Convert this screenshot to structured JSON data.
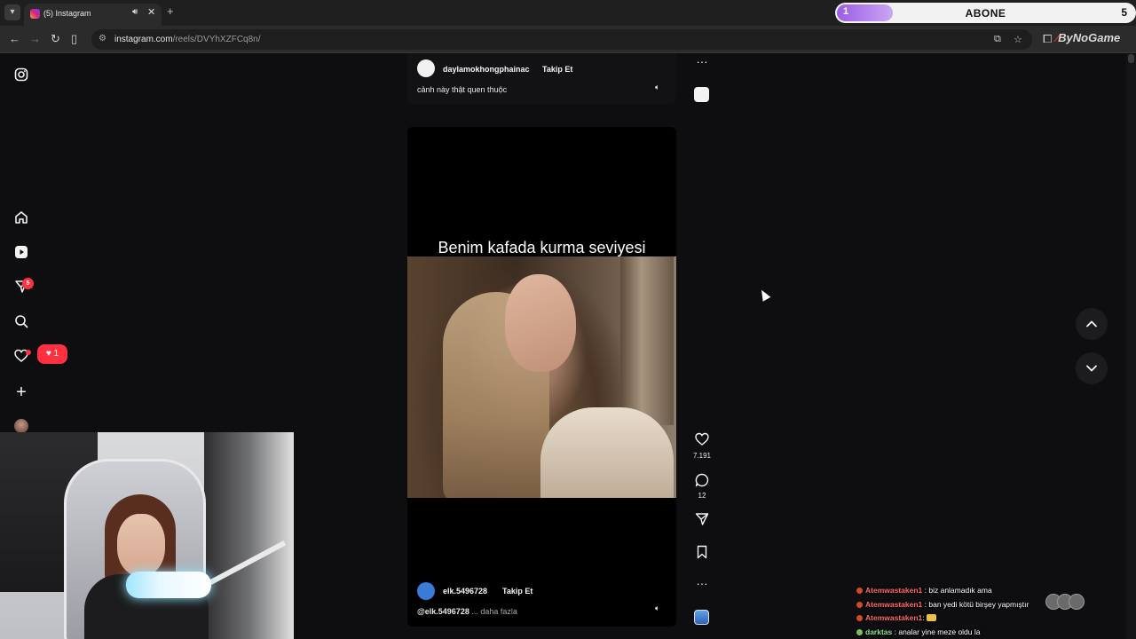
{
  "browser": {
    "tab": {
      "title": "(5) Instagram"
    },
    "url_domain": "instagram.com",
    "url_path": "/reels/DVYhXZFCq8n/",
    "extension_logo": "ByNoGame"
  },
  "abone_bar": {
    "left_value": "1",
    "label": "ABONE",
    "right_value": "5",
    "progress_fraction": 0.2
  },
  "sidebar": {
    "messages_badge": "5",
    "notifications_count": "1"
  },
  "reel_prev": {
    "username": "daylamokhongphainac",
    "follow_label": "Takip Et",
    "caption": "cảnh này thật quen thuộc"
  },
  "reel_main": {
    "overlay_text": "Benim kafada kurma seviyesi",
    "username": "elk.5496728",
    "follow_label": "Takip Et",
    "caption_mention": "@elk.5496728",
    "caption_more": "... daha fazla",
    "likes": "7.191",
    "comments": "12"
  },
  "chat": [
    {
      "user": "Atemwastaken1",
      "message": ": biz anlamadık ama",
      "color": "#ff6b6b"
    },
    {
      "user": "Atemwastaken1",
      "message": ": ban yedi kötü birşey yapmıştır",
      "color": "#ff6b6b"
    },
    {
      "user": "Atemwastaken1",
      "message": ":",
      "color": "#ff6b6b"
    },
    {
      "user": "darktas",
      "message": ": analar yine meze oldu la",
      "color": "#8de38d"
    }
  ],
  "icons": [
    "instagram-icon",
    "home-icon",
    "reels-icon",
    "messages-icon",
    "search-icon",
    "heart-icon",
    "plus-icon",
    "more-icon",
    "like-icon",
    "comment-icon",
    "share-icon",
    "bookmark-icon",
    "chevron-up-icon",
    "chevron-down-icon"
  ]
}
